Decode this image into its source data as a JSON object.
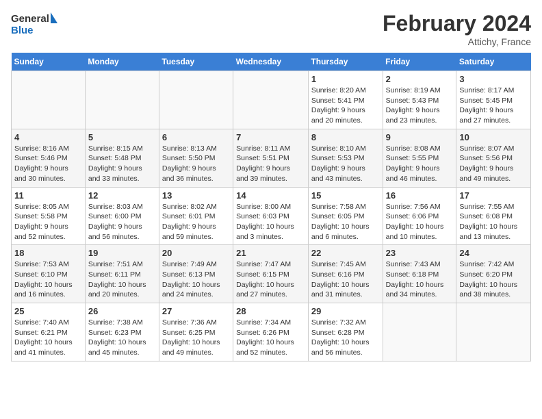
{
  "header": {
    "logo_general": "General",
    "logo_blue": "Blue",
    "month_title": "February 2024",
    "location": "Attichy, France"
  },
  "weekdays": [
    "Sunday",
    "Monday",
    "Tuesday",
    "Wednesday",
    "Thursday",
    "Friday",
    "Saturday"
  ],
  "weeks": [
    [
      {
        "day": "",
        "info": ""
      },
      {
        "day": "",
        "info": ""
      },
      {
        "day": "",
        "info": ""
      },
      {
        "day": "",
        "info": ""
      },
      {
        "day": "1",
        "info": "Sunrise: 8:20 AM\nSunset: 5:41 PM\nDaylight: 9 hours\nand 20 minutes."
      },
      {
        "day": "2",
        "info": "Sunrise: 8:19 AM\nSunset: 5:43 PM\nDaylight: 9 hours\nand 23 minutes."
      },
      {
        "day": "3",
        "info": "Sunrise: 8:17 AM\nSunset: 5:45 PM\nDaylight: 9 hours\nand 27 minutes."
      }
    ],
    [
      {
        "day": "4",
        "info": "Sunrise: 8:16 AM\nSunset: 5:46 PM\nDaylight: 9 hours\nand 30 minutes."
      },
      {
        "day": "5",
        "info": "Sunrise: 8:15 AM\nSunset: 5:48 PM\nDaylight: 9 hours\nand 33 minutes."
      },
      {
        "day": "6",
        "info": "Sunrise: 8:13 AM\nSunset: 5:50 PM\nDaylight: 9 hours\nand 36 minutes."
      },
      {
        "day": "7",
        "info": "Sunrise: 8:11 AM\nSunset: 5:51 PM\nDaylight: 9 hours\nand 39 minutes."
      },
      {
        "day": "8",
        "info": "Sunrise: 8:10 AM\nSunset: 5:53 PM\nDaylight: 9 hours\nand 43 minutes."
      },
      {
        "day": "9",
        "info": "Sunrise: 8:08 AM\nSunset: 5:55 PM\nDaylight: 9 hours\nand 46 minutes."
      },
      {
        "day": "10",
        "info": "Sunrise: 8:07 AM\nSunset: 5:56 PM\nDaylight: 9 hours\nand 49 minutes."
      }
    ],
    [
      {
        "day": "11",
        "info": "Sunrise: 8:05 AM\nSunset: 5:58 PM\nDaylight: 9 hours\nand 52 minutes."
      },
      {
        "day": "12",
        "info": "Sunrise: 8:03 AM\nSunset: 6:00 PM\nDaylight: 9 hours\nand 56 minutes."
      },
      {
        "day": "13",
        "info": "Sunrise: 8:02 AM\nSunset: 6:01 PM\nDaylight: 9 hours\nand 59 minutes."
      },
      {
        "day": "14",
        "info": "Sunrise: 8:00 AM\nSunset: 6:03 PM\nDaylight: 10 hours\nand 3 minutes."
      },
      {
        "day": "15",
        "info": "Sunrise: 7:58 AM\nSunset: 6:05 PM\nDaylight: 10 hours\nand 6 minutes."
      },
      {
        "day": "16",
        "info": "Sunrise: 7:56 AM\nSunset: 6:06 PM\nDaylight: 10 hours\nand 10 minutes."
      },
      {
        "day": "17",
        "info": "Sunrise: 7:55 AM\nSunset: 6:08 PM\nDaylight: 10 hours\nand 13 minutes."
      }
    ],
    [
      {
        "day": "18",
        "info": "Sunrise: 7:53 AM\nSunset: 6:10 PM\nDaylight: 10 hours\nand 16 minutes."
      },
      {
        "day": "19",
        "info": "Sunrise: 7:51 AM\nSunset: 6:11 PM\nDaylight: 10 hours\nand 20 minutes."
      },
      {
        "day": "20",
        "info": "Sunrise: 7:49 AM\nSunset: 6:13 PM\nDaylight: 10 hours\nand 24 minutes."
      },
      {
        "day": "21",
        "info": "Sunrise: 7:47 AM\nSunset: 6:15 PM\nDaylight: 10 hours\nand 27 minutes."
      },
      {
        "day": "22",
        "info": "Sunrise: 7:45 AM\nSunset: 6:16 PM\nDaylight: 10 hours\nand 31 minutes."
      },
      {
        "day": "23",
        "info": "Sunrise: 7:43 AM\nSunset: 6:18 PM\nDaylight: 10 hours\nand 34 minutes."
      },
      {
        "day": "24",
        "info": "Sunrise: 7:42 AM\nSunset: 6:20 PM\nDaylight: 10 hours\nand 38 minutes."
      }
    ],
    [
      {
        "day": "25",
        "info": "Sunrise: 7:40 AM\nSunset: 6:21 PM\nDaylight: 10 hours\nand 41 minutes."
      },
      {
        "day": "26",
        "info": "Sunrise: 7:38 AM\nSunset: 6:23 PM\nDaylight: 10 hours\nand 45 minutes."
      },
      {
        "day": "27",
        "info": "Sunrise: 7:36 AM\nSunset: 6:25 PM\nDaylight: 10 hours\nand 49 minutes."
      },
      {
        "day": "28",
        "info": "Sunrise: 7:34 AM\nSunset: 6:26 PM\nDaylight: 10 hours\nand 52 minutes."
      },
      {
        "day": "29",
        "info": "Sunrise: 7:32 AM\nSunset: 6:28 PM\nDaylight: 10 hours\nand 56 minutes."
      },
      {
        "day": "",
        "info": ""
      },
      {
        "day": "",
        "info": ""
      }
    ]
  ]
}
